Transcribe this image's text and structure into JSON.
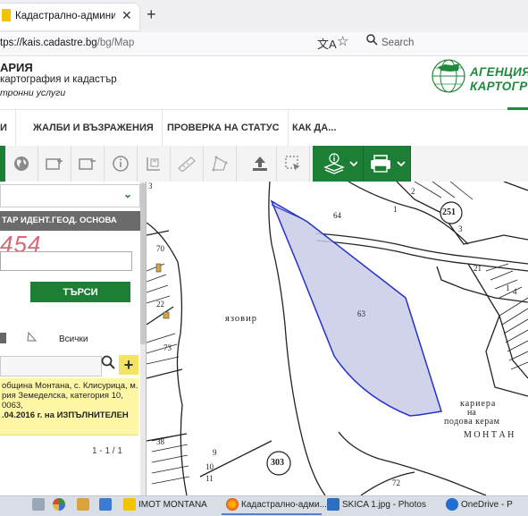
{
  "browser": {
    "tab_title": "Кадастрално-административн",
    "tab_close": "✕",
    "new_tab": "+",
    "url_host": "tps://kais.cadastre.bg",
    "url_path": "/bg/Map",
    "search_label": "Search"
  },
  "site": {
    "title_line1": "АРИЯ",
    "title_line2": "картография и кадастър",
    "title_line3": "тронни услуги",
    "logo_line1": "АГЕНЦИЯ",
    "logo_line2": "КАРТОГР"
  },
  "menu": {
    "items": [
      {
        "label": "И"
      },
      {
        "label": "ЖАЛБИ И ВЪЗРАЖЕНИЯ"
      },
      {
        "label": "ПРОВЕРКА НА СТАТУС"
      },
      {
        "label": "КАК ДА..."
      }
    ]
  },
  "panel": {
    "tab_cadaster": "ТАР ИДЕНТ.",
    "tab_geo": "ГЕОД. ОСНОВА",
    "captcha": "454",
    "search_button": "ТЪРСИ",
    "filter_all": "Всички",
    "result_lines": [
      "община Монтана, с. Клисурица, м.",
      "рия Земеделска, категория 10,",
      "0063,",
      ".04.2016 г. на ИЗПЪЛНИТЕЛЕН"
    ],
    "pager": "1 - 1 / 1"
  },
  "map": {
    "labels": {
      "p3": "3",
      "p2": "2",
      "p1": "1",
      "p64": "64",
      "p251": "251",
      "p3b": "3",
      "p70": "70",
      "p21": "21",
      "p22": "22",
      "p63": "63",
      "p1b": "1",
      "p4": "4",
      "p73": "73",
      "p38": "38",
      "p9": "9",
      "p10": "10",
      "p11": "11",
      "p303": "303",
      "p72": "72",
      "yazovir": "язовир",
      "kariera": "кариера",
      "na": "на",
      "podova": "подова керам",
      "montana": "М О Н Т А Н"
    }
  },
  "taskbar": {
    "items": [
      {
        "label": "IMOT MONTANA"
      },
      {
        "label": "Кадастрално-адми..."
      },
      {
        "label": "SKICA 1.jpg - Photos"
      },
      {
        "label": "OneDrive - P"
      }
    ]
  }
}
